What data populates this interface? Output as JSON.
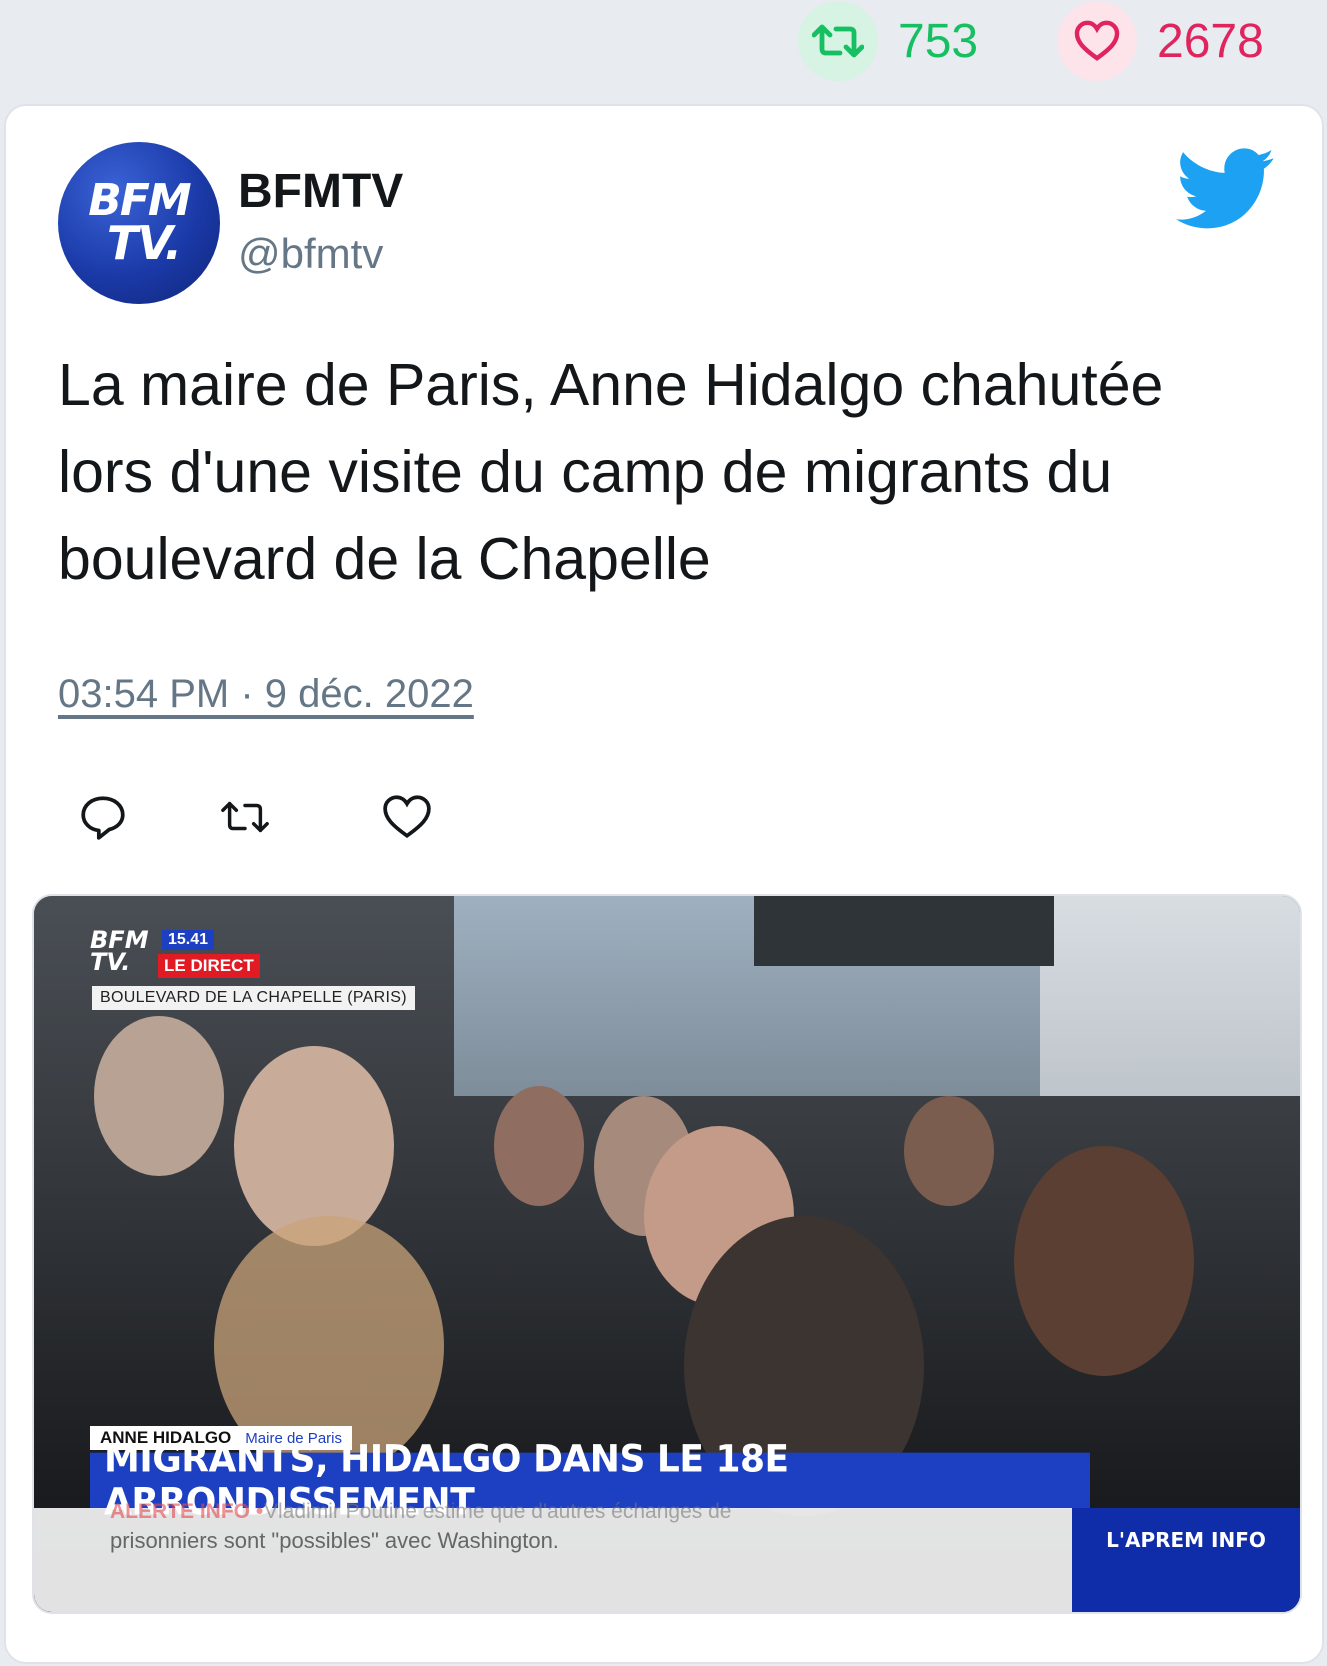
{
  "stats": {
    "retweets": "753",
    "likes": "2678"
  },
  "account": {
    "name": "BFMTV",
    "handle": "@bfmtv",
    "avatar_text_line1": "BFM",
    "avatar_text_line2": "TV."
  },
  "tweet": {
    "text": "La maire de Paris, Anne Hidalgo chahutée lors d'une visite du camp de migrants du boulevard de la Chapelle",
    "timestamp": "03:54 PM · 9 déc. 2022"
  },
  "media": {
    "logo_line1": "BFM",
    "logo_line2": "TV.",
    "time": "15.41",
    "live_label": "LE DIRECT",
    "location": "BOULEVARD DE LA CHAPELLE (PARIS)",
    "person_name": "ANNE HIDALGO",
    "person_role": "Maire de Paris",
    "headline": "MIGRANTS, HIDALGO DANS LE 18E ARRONDISSEMENT",
    "ticker_alert": "ALERTE INFO •",
    "ticker_line1": "Vladimir Poutine estime que d'autres échanges de",
    "ticker_line2": "prisonniers sont \"possibles\" avec Washington.",
    "program": "L'APREM INFO"
  },
  "colors": {
    "retweet_green": "#17bf63",
    "like_red": "#e0245e",
    "twitter_blue": "#1da1f2",
    "bfm_blue": "#1d3fc2",
    "bfm_red": "#e01b24"
  },
  "icons": {
    "retweet": "retweet-icon",
    "like": "heart-icon",
    "reply": "reply-icon",
    "brand": "twitter-bird-icon"
  }
}
